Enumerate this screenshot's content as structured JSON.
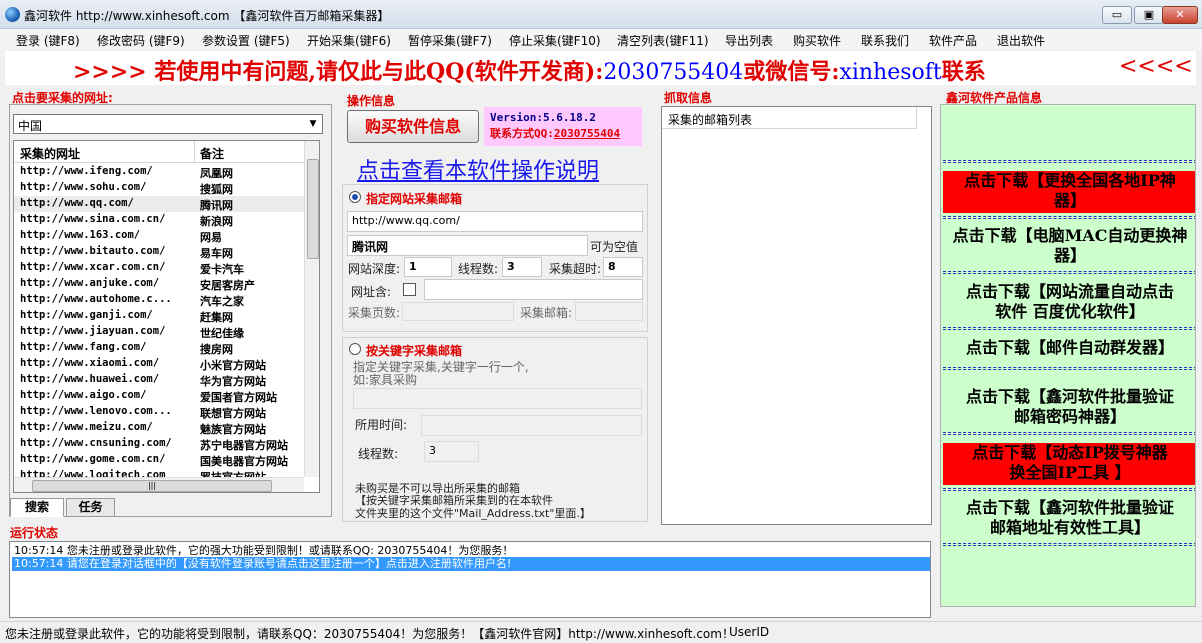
{
  "window": {
    "title": "鑫河软件 http://www.xinhesoft.com 【鑫河软件百万邮箱采集器】",
    "min_label": "▭",
    "max_label": "▣",
    "close_label": "✕"
  },
  "menu": [
    "登录 (键F8)",
    "修改密码 (键F9)",
    "参数设置 (键F5)",
    "开始采集(键F6)",
    "暂停采集(键F7)",
    "停止采集(键F10)",
    "清空列表(键F11)",
    "导出列表",
    "购买软件",
    "联系我们",
    "软件产品",
    "退出软件"
  ],
  "banner": {
    "left_arrows": ">>>>",
    "text_pre": " 若使用中有问题,请仅此与此QQ(软件开发商):",
    "qq": "2030755404",
    "mid": "或微信号:",
    "wechat": "xinhesoft",
    "text_post": "联系",
    "right_arrows": "<<<<"
  },
  "left": {
    "title": "点击要采集的网址:",
    "region": "中国",
    "col_url": "采集的网址",
    "col_note": "备注",
    "rows": [
      {
        "url": "http://www.ifeng.com/",
        "note": "凤凰网"
      },
      {
        "url": "http://www.sohu.com/",
        "note": "搜狐网"
      },
      {
        "url": "http://www.qq.com/",
        "note": "腾讯网"
      },
      {
        "url": "http://www.sina.com.cn/",
        "note": "新浪网"
      },
      {
        "url": "http://www.163.com/",
        "note": "网易"
      },
      {
        "url": "http://www.bitauto.com/",
        "note": "易车网"
      },
      {
        "url": "http://www.xcar.com.cn/",
        "note": "爱卡汽车"
      },
      {
        "url": "http://www.anjuke.com/",
        "note": "安居客房产"
      },
      {
        "url": "http://www.autohome.c...",
        "note": "汽车之家"
      },
      {
        "url": "http://www.ganji.com/",
        "note": "赶集网"
      },
      {
        "url": "http://www.jiayuan.com/",
        "note": "世纪佳缘"
      },
      {
        "url": "http://www.fang.com/",
        "note": "搜房网"
      },
      {
        "url": "http://www.xiaomi.com/",
        "note": "小米官方网站"
      },
      {
        "url": "http://www.huawei.com/",
        "note": "华为官方网站"
      },
      {
        "url": "http://www.aigo.com/",
        "note": "爱国者官方网站"
      },
      {
        "url": "http://www.lenovo.com...",
        "note": "联想官方网站"
      },
      {
        "url": "http://www.meizu.com/",
        "note": "魅族官方网站"
      },
      {
        "url": "http://www.cnsuning.com/",
        "note": "苏宁电器官方网站"
      },
      {
        "url": "http://www.gome.com.cn/",
        "note": "国美电器官方网站"
      },
      {
        "url": "http://www.logitech.com",
        "note": "罗技官方网站"
      }
    ],
    "tab_search": "搜索",
    "tab_task": "任务"
  },
  "op": {
    "title": "操作信息",
    "buy_button": "购买软件信息",
    "version": "Version:5.6.18.2",
    "contact_label": "联系方式QQ:",
    "contact_qq": "2030755404",
    "manual_link": "点击查看本软件操作说明",
    "site_mode_label": "指定网站采集邮箱",
    "site_url": "http://www.qq.com/",
    "site_name": "腾讯网",
    "can_empty": "可为空值",
    "depth_label": "网站深度:",
    "depth_value": "1",
    "threads_label": "线程数:",
    "threads_value": "3",
    "timeout_label": "采集超时:",
    "timeout_value": "8",
    "url_contains_label": "网址含:",
    "pages_label": "采集页数:",
    "mails_label": "采集邮箱:",
    "kw_mode_label": "按关键字采集邮箱",
    "kw_hint1": "指定关键字采集,关键字一行一个,",
    "kw_hint2": "如:家具采购",
    "time_used_label": "所用时间:",
    "kw_threads_label": "线程数:",
    "kw_threads_value": "3",
    "note1": "未购买是不可以导出所采集的邮箱",
    "note2": "【按关键字采集邮箱所采集到的在本软件",
    "note3": "文件夹里的这个文件\"Mail_Address.txt\"里面.】"
  },
  "grab": {
    "title": "抓取信息",
    "list_header": "采集的邮箱列表"
  },
  "products": {
    "title": "鑫河软件产品信息",
    "items": [
      {
        "l1": "点击下载【更换全国各地IP神",
        "l2": "器】"
      },
      {
        "l1": "点击下载【电脑MAC自动更换神",
        "l2": "器】"
      },
      {
        "l1": "点击下载【网站流量自动点击",
        "l2": "软件 百度优化软件】"
      },
      {
        "l1": "点击下载【邮件自动群发器】",
        "l2": ""
      },
      {
        "l1": "点击下载【鑫河软件批量验证",
        "l2": "邮箱密码神器】"
      },
      {
        "l1": "点击下载【动态IP拨号神器",
        "l2": "换全国IP工具 】"
      },
      {
        "l1": "点击下载【鑫河软件批量验证",
        "l2": "邮箱地址有效性工具】"
      }
    ]
  },
  "status": {
    "title": "运行状态",
    "log": [
      "10:57:14 您未注册或登录此软件，它的强大功能受到限制！或请联系QQ: 2030755404！为您服务！",
      "10:57:14 请您在登录对话框中的【没有软件登录账号请点击这里注册一个】点击进入注册软件用户名!"
    ],
    "bar_text": "您未注册或登录此软件，它的功能将受到限制，请联系QQ：2030755404！为您服务！【鑫河软件官网】http://www.xinhesoft.com！",
    "userid": "UserID"
  },
  "colors": {
    "accent_red": "#e00000",
    "link_blue": "#1a1aee",
    "product_bg": "#ccffcc",
    "version_bg": "#ffc8ff",
    "selection_blue": "#3399ff"
  }
}
